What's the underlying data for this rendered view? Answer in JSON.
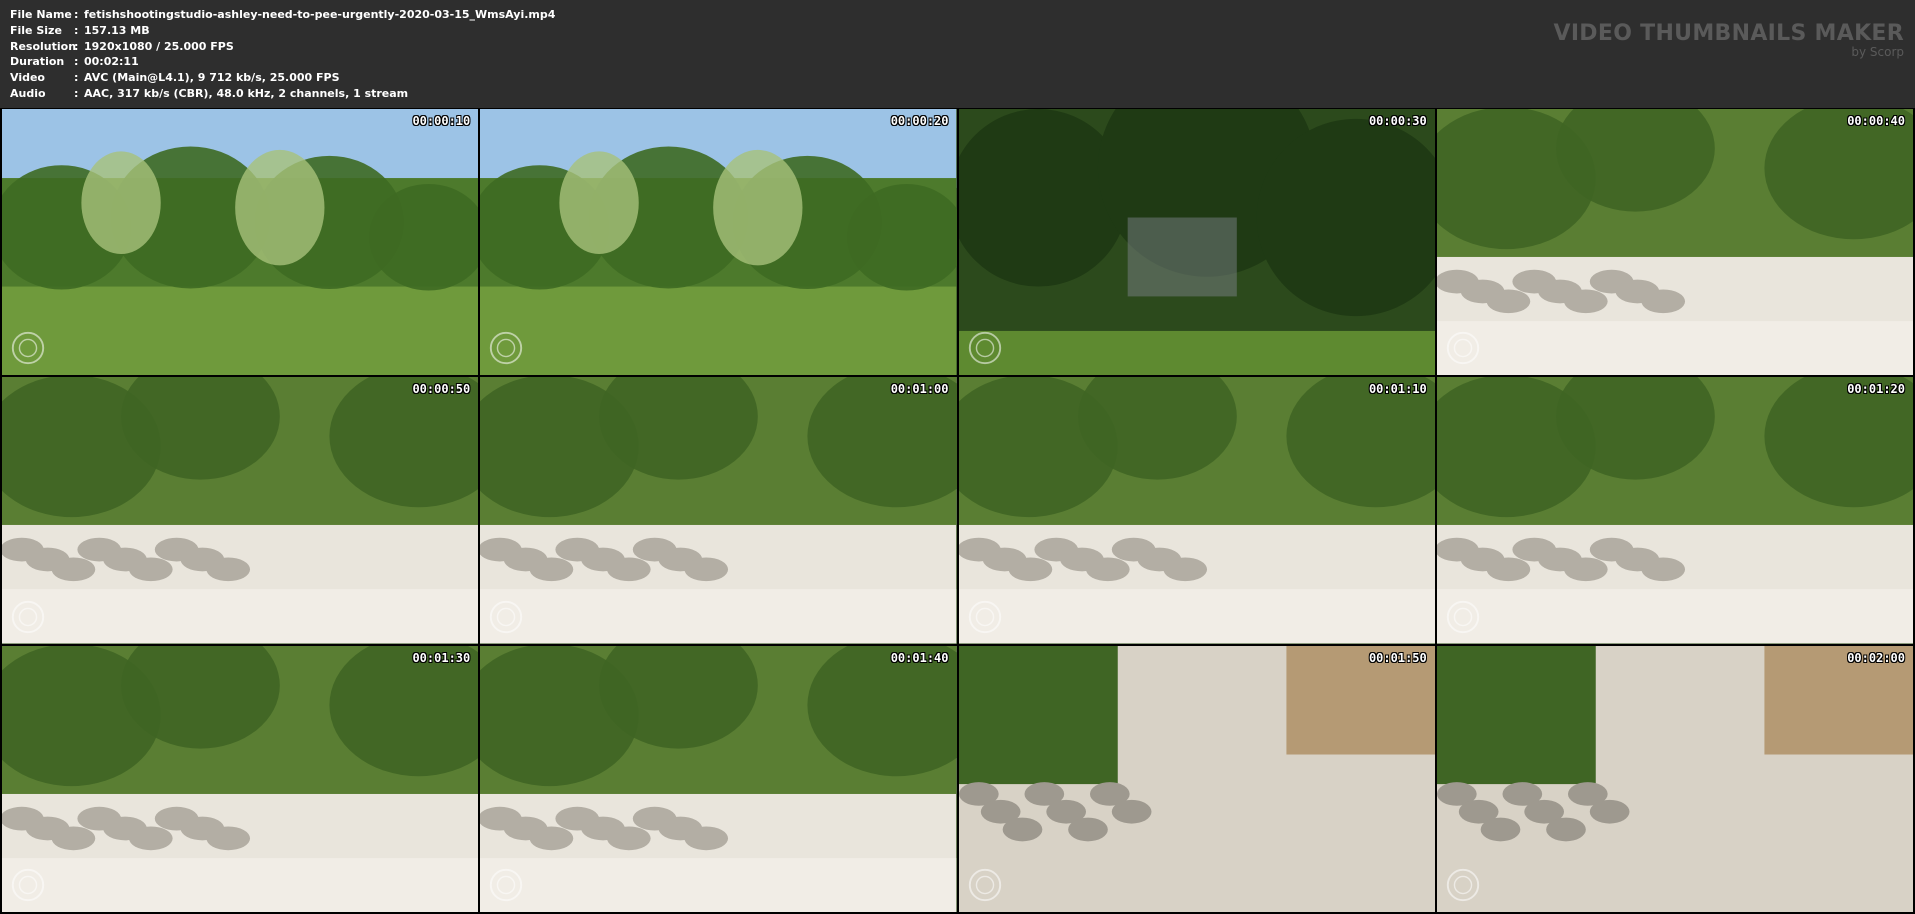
{
  "file_info": [
    {
      "label": "File Name",
      "value": "fetishshootingstudio-ashley-need-to-pee-urgently-2020-03-15_WmsAyi.mp4"
    },
    {
      "label": "File Size",
      "value": "157.13 MB"
    },
    {
      "label": "Resolution",
      "value": "1920x1080 / 25.000 FPS"
    },
    {
      "label": "Duration",
      "value": "00:02:11"
    },
    {
      "label": "Video",
      "value": "AVC (Main@L4.1), 9 712 kb/s, 25.000 FPS"
    },
    {
      "label": "Audio",
      "value": "AAC, 317 kb/s (CBR), 48.0 kHz, 2 channels, 1 stream"
    }
  ],
  "brand": {
    "title": "VIDEO THUMBNAILS MAKER",
    "subtitle": "by Scorp"
  },
  "thumbnails": [
    {
      "timestamp": "00:00:10",
      "scene": "garden-grass"
    },
    {
      "timestamp": "00:00:20",
      "scene": "garden-grass"
    },
    {
      "timestamp": "00:00:30",
      "scene": "dark-foliage"
    },
    {
      "timestamp": "00:00:40",
      "scene": "stone-patio"
    },
    {
      "timestamp": "00:00:50",
      "scene": "stone-patio"
    },
    {
      "timestamp": "00:01:00",
      "scene": "stone-patio"
    },
    {
      "timestamp": "00:01:10",
      "scene": "stone-patio"
    },
    {
      "timestamp": "00:01:20",
      "scene": "stone-patio"
    },
    {
      "timestamp": "00:01:30",
      "scene": "stone-patio"
    },
    {
      "timestamp": "00:01:40",
      "scene": "stone-patio"
    },
    {
      "timestamp": "00:01:50",
      "scene": "olive-dress"
    },
    {
      "timestamp": "00:02:00",
      "scene": "olive-dress"
    }
  ],
  "colors": {
    "header_bg": "#2e2e2e",
    "grid_bg": "#000000",
    "text": "#ffffff",
    "brand": "#5a5a5a"
  }
}
